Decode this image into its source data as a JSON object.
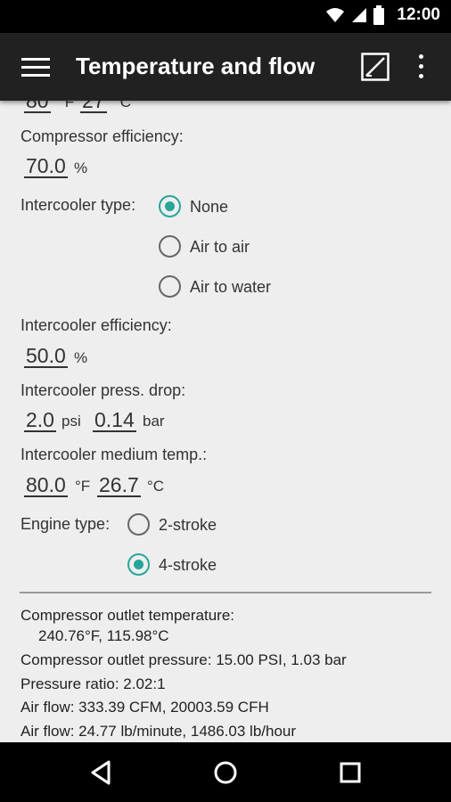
{
  "status_bar": {
    "time": "12:00"
  },
  "app_bar": {
    "title": "Temperature and flow"
  },
  "partial_top": {
    "value_f": "80",
    "unit_f": "°F",
    "value_c": "27",
    "unit_c": "°C"
  },
  "compressor_efficiency": {
    "label": "Compressor efficiency:",
    "value": "70.0",
    "unit": "%"
  },
  "intercooler_type": {
    "label": "Intercooler type:",
    "options": [
      {
        "label": "None",
        "checked": true
      },
      {
        "label": "Air to air",
        "checked": false
      },
      {
        "label": "Air to water",
        "checked": false
      }
    ]
  },
  "intercooler_efficiency": {
    "label": "Intercooler efficiency:",
    "value": "50.0",
    "unit": "%"
  },
  "intercooler_press_drop": {
    "label": "Intercooler press. drop:",
    "value_psi": "2.0",
    "unit_psi": "psi",
    "value_bar": "0.14",
    "unit_bar": "bar"
  },
  "intercooler_medium_temp": {
    "label": "Intercooler medium temp.:",
    "value_f": "80.0",
    "unit_f": "°F",
    "value_c": "26.7",
    "unit_c": "°C"
  },
  "engine_type": {
    "label": "Engine type:",
    "options": [
      {
        "label": "2-stroke",
        "checked": false
      },
      {
        "label": "4-stroke",
        "checked": true
      }
    ]
  },
  "results": {
    "outlet_temp_label": "Compressor outlet temperature:",
    "outlet_temp_value": "240.76°F, 115.98°C",
    "outlet_pressure": "Compressor outlet pressure: 15.00 PSI, 1.03 bar",
    "pressure_ratio": "Pressure ratio: 2.02:1",
    "air_flow_cfm": "Air flow: 333.39 CFM, 20003.59 CFH",
    "air_flow_lb": "Air flow: 24.77 lb/minute, 1486.03 lb/hour"
  },
  "colors": {
    "accent": "#26a69a",
    "app_bar": "#212121",
    "background": "#eeeeee"
  },
  "icons": {
    "menu": "menu-icon",
    "edit": "edit-icon",
    "more": "more-vert-icon",
    "back": "back-icon",
    "home": "home-icon",
    "recents": "recents-icon"
  }
}
